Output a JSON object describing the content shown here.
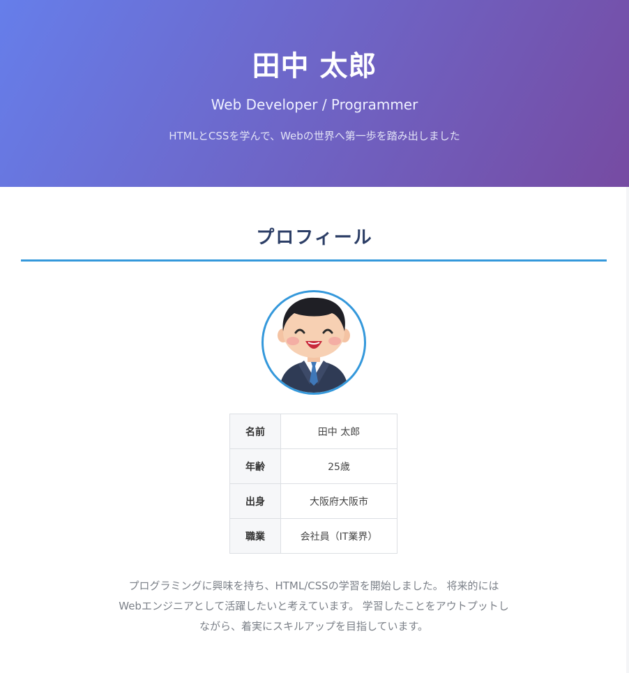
{
  "header": {
    "name": "田中 太郎",
    "role": "Web Developer / Programmer",
    "tagline": "HTMLとCSSを学んで、Webの世界へ第一歩を踏み出しました",
    "gradient_start": "#667eea",
    "gradient_end": "#764ba2"
  },
  "profile": {
    "section_title": "プロフィール",
    "accent_color": "#3498db",
    "avatar_icon": "businessman-avatar-icon",
    "table": [
      {
        "label": "名前",
        "value": "田中 太郎"
      },
      {
        "label": "年齢",
        "value": "25歳"
      },
      {
        "label": "出身",
        "value": "大阪府大阪市"
      },
      {
        "label": "職業",
        "value": "会社員（IT業界）"
      }
    ],
    "bio_lines": [
      "プログラミングに興味を持ち、HTML/CSSの学習を開始しました。 将来的には",
      "Webエンジニアとして活躍したいと考えています。 学習したことをアウトプットし",
      "ながら、着実にスキルアップを目指しています。"
    ]
  }
}
